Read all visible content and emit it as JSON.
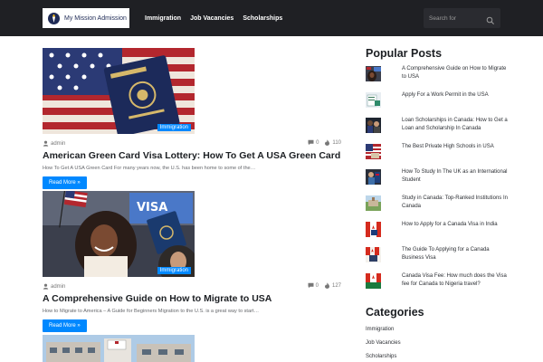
{
  "header": {
    "logo_text": "My Mission Admission",
    "nav": [
      "Immigration",
      "Job Vacancies",
      "Scholarships"
    ],
    "search_placeholder": "Search for"
  },
  "posts": [
    {
      "category": "Immigration",
      "author": "admin",
      "comments": "0",
      "views": "110",
      "title": "American Green Card Visa Lottery: How To Get A USA Green Card",
      "excerpt": "How To Get A USA Green Card For many years now, the U.S. has been home to some of the…",
      "read_more": "Read More »"
    },
    {
      "category": "Immigration",
      "author": "admin",
      "comments": "0",
      "views": "127",
      "title": "A Comprehensive Guide on How to Migrate to USA",
      "excerpt": "How to Migrate to America – A Guide for Beginners Migration to the U.S. is a great way to start…",
      "read_more": "Read More »"
    }
  ],
  "sidebar": {
    "popular_title": "Popular Posts",
    "popular": [
      "A Comprehensive Guide on How to Migrate to USA",
      "Apply For a Work Permit in the USA",
      "Loan Scholarships in Canada: How to Get a Loan and Scholarship In Canada",
      "The Best Private High Schools in USA",
      "How To Study In The UK as an International Student",
      "Study in Canada: Top-Ranked Institutions In Canada",
      "How to Apply for a Canada Visa in India",
      "The Guide To Applying for a Canada Business Visa",
      "Canada Visa Fee: How much does the Visa fee for Canada to Nigeria travel?"
    ],
    "categories_title": "Categories",
    "categories": [
      "Immigration",
      "Job Vacancies",
      "Scholarships"
    ]
  },
  "colors": {
    "header_bg": "#1f2024",
    "accent": "#0088ff",
    "text": "#1c1f23"
  }
}
